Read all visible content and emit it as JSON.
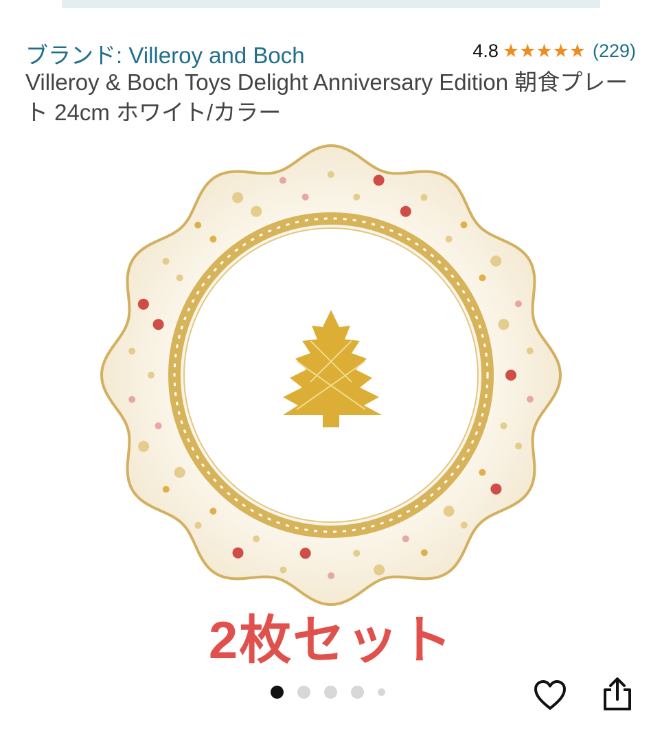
{
  "header": {
    "brand_link": "ブランド: Villeroy and Boch",
    "rating_value": "4.8",
    "review_count": "(229)",
    "star_color": "#f08b1f",
    "link_color": "#1f6f8b"
  },
  "product": {
    "title": "Villeroy & Boch Toys Delight Anniversary Edition 朝食プレート 24cm ホワイト/カラー"
  },
  "image": {
    "promo_text": "2枚セット",
    "promo_color": "#e0514d"
  },
  "carousel": {
    "total_dots": 5,
    "active_index": 0
  },
  "actions": {
    "favorite_icon": "heart-icon",
    "share_icon": "share-icon"
  }
}
